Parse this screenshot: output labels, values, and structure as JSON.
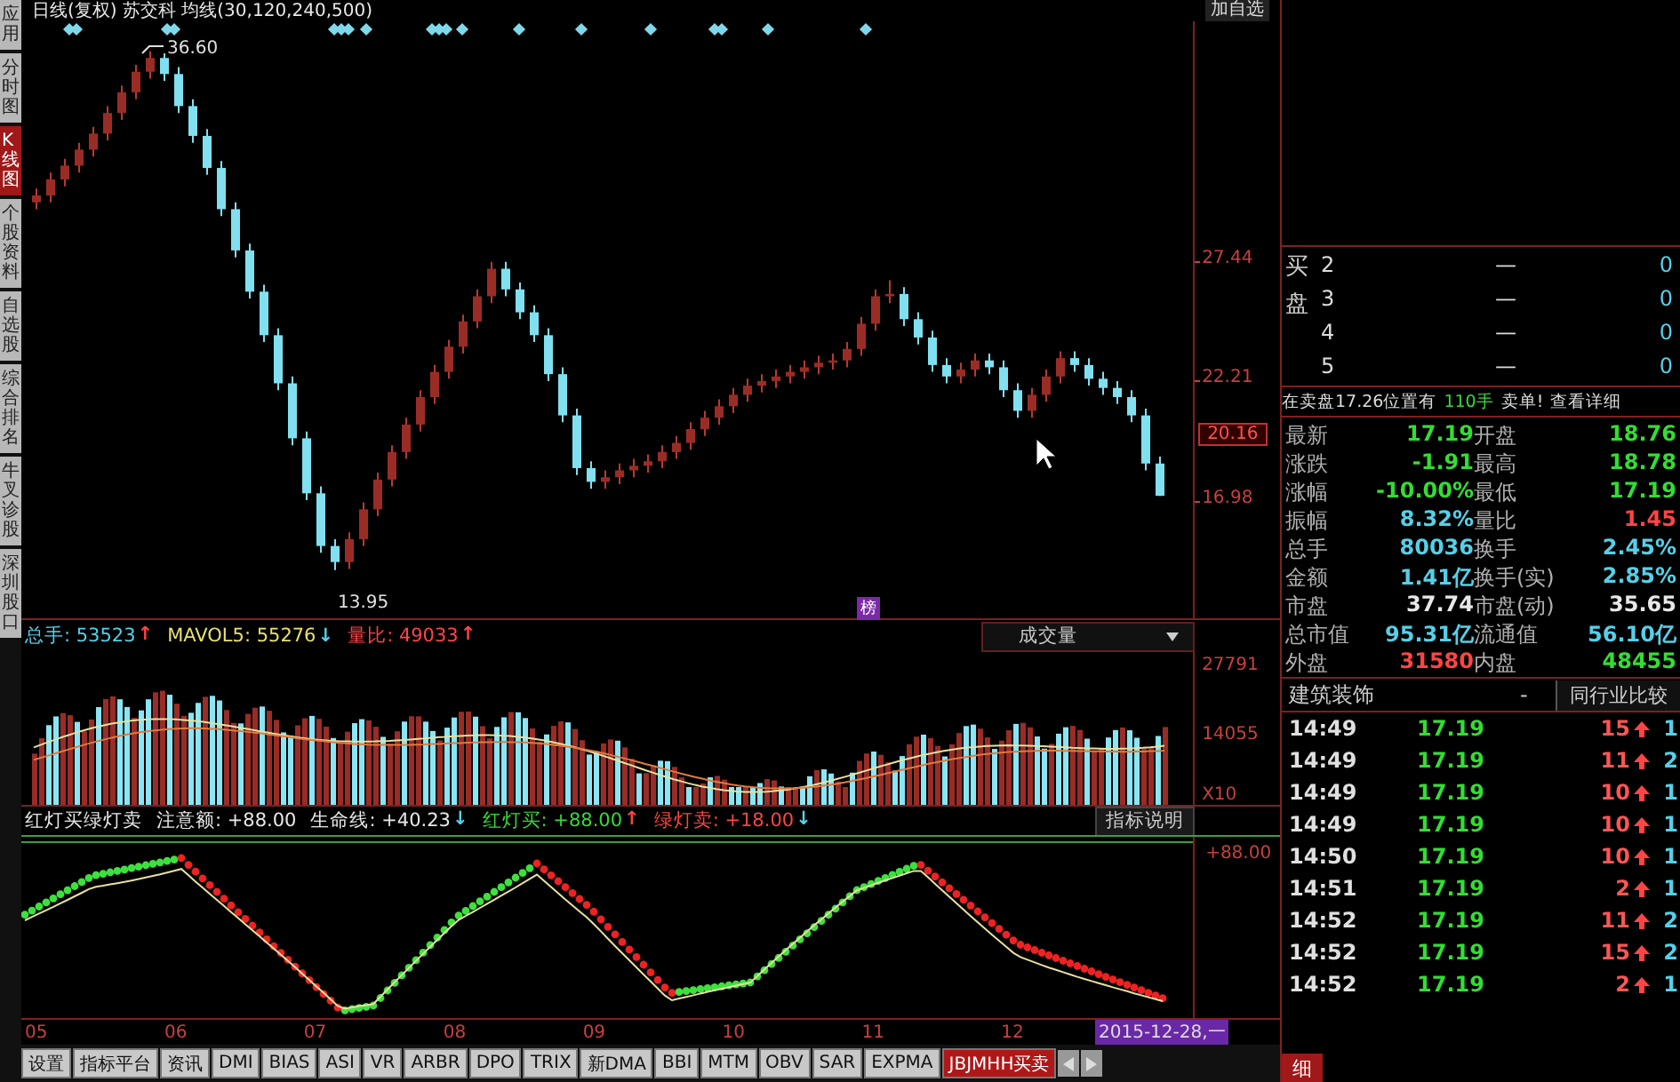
{
  "header": {
    "title": "日线(复权) 苏交科 均线(30,120,240,500)",
    "add_watchlist": "加自选"
  },
  "side_tabs": [
    {
      "label": "应用",
      "selected": false
    },
    {
      "label": "分时图",
      "selected": false
    },
    {
      "label": "K线图",
      "selected": true
    },
    {
      "label": "个股资料",
      "selected": false
    },
    {
      "label": "自选股",
      "selected": false
    },
    {
      "label": "综合排名",
      "selected": false
    },
    {
      "label": "牛叉诊股",
      "selected": false
    },
    {
      "label": "深圳股口",
      "selected": false
    }
  ],
  "price_chart": {
    "high_label": "36.60",
    "low_label": "13.95",
    "current_price": "20.16",
    "marker": "榜",
    "chart_data": {
      "type": "candlestick",
      "ylim": [
        12.0,
        37.9
      ],
      "yticks": [
        {
          "value": 27.44,
          "label": "27.44"
        },
        {
          "value": 22.21,
          "label": "22.21"
        },
        {
          "value": 16.98,
          "label": "16.98"
        }
      ],
      "ohlc": [
        [
          30.0,
          30.6,
          29.7,
          30.3
        ],
        [
          30.3,
          31.3,
          30.0,
          31.0
        ],
        [
          31.0,
          31.9,
          30.7,
          31.6
        ],
        [
          31.6,
          32.6,
          31.3,
          32.3
        ],
        [
          32.3,
          33.3,
          32.0,
          33.0
        ],
        [
          33.0,
          34.2,
          32.7,
          33.9
        ],
        [
          33.9,
          35.1,
          33.6,
          34.8
        ],
        [
          34.8,
          36.0,
          34.5,
          35.7
        ],
        [
          35.7,
          36.6,
          35.4,
          36.3
        ],
        [
          36.3,
          36.5,
          35.3,
          35.6
        ],
        [
          35.6,
          35.9,
          33.9,
          34.2
        ],
        [
          34.2,
          34.5,
          32.6,
          32.9
        ],
        [
          32.9,
          33.2,
          31.2,
          31.5
        ],
        [
          31.5,
          31.8,
          29.4,
          29.7
        ],
        [
          29.7,
          30.0,
          27.6,
          27.9
        ],
        [
          27.9,
          28.2,
          25.8,
          26.1
        ],
        [
          26.1,
          26.4,
          23.9,
          24.2
        ],
        [
          24.2,
          24.5,
          21.8,
          22.1
        ],
        [
          22.1,
          22.4,
          19.4,
          19.7
        ],
        [
          19.7,
          20.0,
          17.0,
          17.3
        ],
        [
          17.3,
          17.6,
          14.7,
          15.0
        ],
        [
          15.0,
          15.3,
          13.95,
          14.3
        ],
        [
          14.3,
          15.6,
          14.0,
          15.3
        ],
        [
          15.3,
          16.9,
          15.0,
          16.6
        ],
        [
          16.6,
          18.2,
          16.3,
          17.9
        ],
        [
          17.9,
          19.4,
          17.6,
          19.1
        ],
        [
          19.1,
          20.6,
          18.8,
          20.3
        ],
        [
          20.3,
          21.8,
          20.0,
          21.5
        ],
        [
          21.5,
          22.9,
          21.2,
          22.6
        ],
        [
          22.6,
          24.0,
          22.3,
          23.7
        ],
        [
          23.7,
          25.1,
          23.4,
          24.8
        ],
        [
          24.8,
          26.2,
          24.5,
          25.9
        ],
        [
          25.9,
          27.4,
          25.6,
          27.1
        ],
        [
          27.1,
          27.4,
          25.9,
          26.2
        ],
        [
          26.2,
          26.5,
          24.9,
          25.2
        ],
        [
          25.2,
          25.5,
          23.9,
          24.2
        ],
        [
          24.2,
          24.5,
          22.2,
          22.5
        ],
        [
          22.5,
          22.8,
          20.4,
          20.7
        ],
        [
          20.7,
          21.0,
          18.1,
          18.4
        ],
        [
          18.4,
          18.7,
          17.5,
          17.8
        ],
        [
          17.8,
          18.3,
          17.5,
          18.0
        ],
        [
          18.0,
          18.6,
          17.7,
          18.3
        ],
        [
          18.3,
          18.8,
          18.0,
          18.5
        ],
        [
          18.5,
          19.0,
          18.2,
          18.7
        ],
        [
          18.7,
          19.4,
          18.4,
          19.1
        ],
        [
          19.1,
          19.8,
          18.8,
          19.5
        ],
        [
          19.5,
          20.4,
          19.2,
          20.1
        ],
        [
          20.1,
          20.9,
          19.8,
          20.6
        ],
        [
          20.6,
          21.4,
          20.3,
          21.1
        ],
        [
          21.1,
          21.9,
          20.8,
          21.6
        ],
        [
          21.6,
          22.3,
          21.3,
          22.0
        ],
        [
          22.0,
          22.5,
          21.7,
          22.2
        ],
        [
          22.2,
          22.7,
          21.9,
          22.4
        ],
        [
          22.4,
          22.9,
          22.1,
          22.6
        ],
        [
          22.6,
          23.1,
          22.3,
          22.8
        ],
        [
          22.8,
          23.3,
          22.5,
          23.0
        ],
        [
          23.0,
          23.4,
          22.7,
          23.1
        ],
        [
          23.1,
          23.9,
          22.8,
          23.6
        ],
        [
          23.6,
          25.0,
          23.3,
          24.7
        ],
        [
          24.7,
          26.2,
          24.4,
          25.9
        ],
        [
          25.9,
          26.6,
          25.6,
          26.0
        ],
        [
          26.0,
          26.3,
          24.6,
          24.9
        ],
        [
          24.9,
          25.2,
          23.8,
          24.1
        ],
        [
          24.1,
          24.4,
          22.6,
          22.9
        ],
        [
          22.9,
          23.2,
          22.1,
          22.4
        ],
        [
          22.4,
          23.0,
          22.1,
          22.7
        ],
        [
          22.7,
          23.4,
          22.4,
          23.1
        ],
        [
          23.1,
          23.4,
          22.5,
          22.8
        ],
        [
          22.8,
          23.1,
          21.5,
          21.8
        ],
        [
          21.8,
          22.1,
          20.6,
          20.9
        ],
        [
          20.9,
          21.9,
          20.6,
          21.6
        ],
        [
          21.6,
          22.7,
          21.3,
          22.4
        ],
        [
          22.4,
          23.5,
          22.1,
          23.2
        ],
        [
          23.2,
          23.5,
          22.6,
          22.9
        ],
        [
          22.9,
          23.2,
          22.0,
          22.3
        ],
        [
          22.3,
          22.6,
          21.6,
          21.9
        ],
        [
          21.9,
          22.2,
          21.2,
          21.5
        ],
        [
          21.5,
          21.8,
          20.4,
          20.7
        ],
        [
          20.7,
          21.0,
          18.3,
          18.6
        ],
        [
          18.6,
          18.9,
          17.19,
          17.19
        ]
      ]
    }
  },
  "volume": {
    "stats": [
      {
        "label": "总手:",
        "value": "53523",
        "color": "#55d0e8",
        "arrow": {
          "text": "↑",
          "color": "#ff4444"
        }
      },
      {
        "label": "MAVOL5:",
        "value": "55276",
        "color": "#e8e070",
        "arrow": {
          "text": "↓",
          "color": "#55d0e8"
        }
      },
      {
        "label": "量比:",
        "value": "49033",
        "color": "#ff4444",
        "arrow": {
          "text": "↑",
          "color": "#ff4444"
        }
      }
    ],
    "selector": "成交量",
    "axis_labels": [
      "27791",
      "14055",
      "X10"
    ]
  },
  "indicator": {
    "title": "红灯买绿灯卖",
    "stats": [
      {
        "label": "注意额:",
        "value": "+88.00",
        "color": "#e8e8e8"
      },
      {
        "label": "生命线:",
        "value": "+40.23",
        "color": "#e8e8e8",
        "arrow": {
          "text": "↓",
          "color": "#55d0e8"
        }
      },
      {
        "label": "红灯买:",
        "value": "+88.00",
        "color": "#33dd33",
        "arrow": {
          "text": "↑",
          "color": "#ff4444"
        }
      },
      {
        "label": "绿灯卖:",
        "value": "+18.00",
        "color": "#ff4444",
        "arrow": {
          "text": "↓",
          "color": "#55d0e8"
        }
      }
    ],
    "button": "指标说明",
    "axis_label": "+88.00"
  },
  "x_axis": {
    "months": [
      "05",
      "06",
      "07",
      "08",
      "09",
      "10",
      "11",
      "12"
    ],
    "date": "2015-12-28,一"
  },
  "bottom_tabs": [
    {
      "label": "设置",
      "selected": false
    },
    {
      "label": "指标平台",
      "selected": false
    },
    {
      "label": "资讯",
      "selected": false
    },
    {
      "label": "DMI",
      "selected": false
    },
    {
      "label": "BIAS",
      "selected": false
    },
    {
      "label": "ASI",
      "selected": false
    },
    {
      "label": "VR",
      "selected": false
    },
    {
      "label": "ARBR",
      "selected": false
    },
    {
      "label": "DPO",
      "selected": false
    },
    {
      "label": "TRIX",
      "selected": false
    },
    {
      "label": "新DMA",
      "selected": false
    },
    {
      "label": "BBI",
      "selected": false
    },
    {
      "label": "MTM",
      "selected": false
    },
    {
      "label": "OBV",
      "selected": false
    },
    {
      "label": "SAR",
      "selected": false
    },
    {
      "label": "EXPMA",
      "selected": false
    },
    {
      "label": "JBJMHH买卖",
      "selected": true
    }
  ],
  "order_book": {
    "side_label": "买盘",
    "rows": [
      {
        "rank": "2",
        "price": "—",
        "volume": "0"
      },
      {
        "rank": "3",
        "price": "—",
        "volume": "0"
      },
      {
        "rank": "4",
        "price": "—",
        "volume": "0"
      },
      {
        "rank": "5",
        "price": "—",
        "volume": "0"
      }
    ]
  },
  "notice": {
    "text": "在卖盘17.26位置有",
    "lots": "110手",
    "link": "卖单!",
    "detail": "查看详细"
  },
  "quote": [
    {
      "label": "最新",
      "value": "17.19",
      "color": "#33dd33"
    },
    {
      "label": "开盘",
      "value": "18.76",
      "color": "#33dd33"
    },
    {
      "label": "涨跌",
      "value": "-1.91",
      "color": "#33dd33"
    },
    {
      "label": "最高",
      "value": "18.78",
      "color": "#33dd33"
    },
    {
      "label": "涨幅",
      "value": "-10.00%",
      "color": "#33dd33"
    },
    {
      "label": "最低",
      "value": "17.19",
      "color": "#33dd33"
    },
    {
      "label": "振幅",
      "value": "8.32%",
      "color": "#55d0e8"
    },
    {
      "label": "量比",
      "value": "1.45",
      "color": "#ff4444"
    },
    {
      "label": "总手",
      "value": "80036",
      "color": "#55d0e8"
    },
    {
      "label": "换手",
      "value": "2.45%",
      "color": "#55d0e8"
    },
    {
      "label": "金额",
      "value": "1.41亿",
      "color": "#55d0e8"
    },
    {
      "label": "换手(实)",
      "value": "2.85%",
      "color": "#55d0e8"
    },
    {
      "label": "市盘",
      "value": "37.74",
      "color": "#e8e8e8"
    },
    {
      "label": "市盘(动)",
      "value": "35.65",
      "color": "#e8e8e8"
    },
    {
      "label": "总市值",
      "value": "95.31亿",
      "color": "#55d0e8"
    },
    {
      "label": "流通值",
      "value": "56.10亿",
      "color": "#55d0e8"
    },
    {
      "label": "外盘",
      "value": "31580",
      "color": "#ff4444"
    },
    {
      "label": "内盘",
      "value": "48455",
      "color": "#33dd33"
    }
  ],
  "sector": {
    "name": "建筑装饰",
    "separator": "-",
    "compare": "同行业比较"
  },
  "trades": [
    {
      "time": "14:49",
      "price": "17.19",
      "volume": "15",
      "column_4": "1",
      "kind": "up"
    },
    {
      "time": "14:49",
      "price": "17.19",
      "volume": "11",
      "column_4": "2",
      "kind": "up"
    },
    {
      "time": "14:49",
      "price": "17.19",
      "volume": "10",
      "column_4": "1",
      "kind": "up"
    },
    {
      "time": "14:49",
      "price": "17.19",
      "volume": "10",
      "column_4": "1",
      "kind": "up"
    },
    {
      "time": "14:50",
      "price": "17.19",
      "volume": "10",
      "column_4": "1",
      "kind": "up"
    },
    {
      "time": "14:51",
      "price": "17.19",
      "volume": "2",
      "column_4": "1",
      "kind": "up"
    },
    {
      "time": "14:52",
      "price": "17.19",
      "volume": "11",
      "column_4": "2",
      "kind": "up"
    },
    {
      "time": "14:52",
      "price": "17.19",
      "volume": "15",
      "column_4": "2",
      "kind": "up"
    },
    {
      "time": "14:52",
      "price": "17.19",
      "volume": "2",
      "column_4": "1",
      "kind": "up"
    }
  ],
  "detail_tab": "细"
}
